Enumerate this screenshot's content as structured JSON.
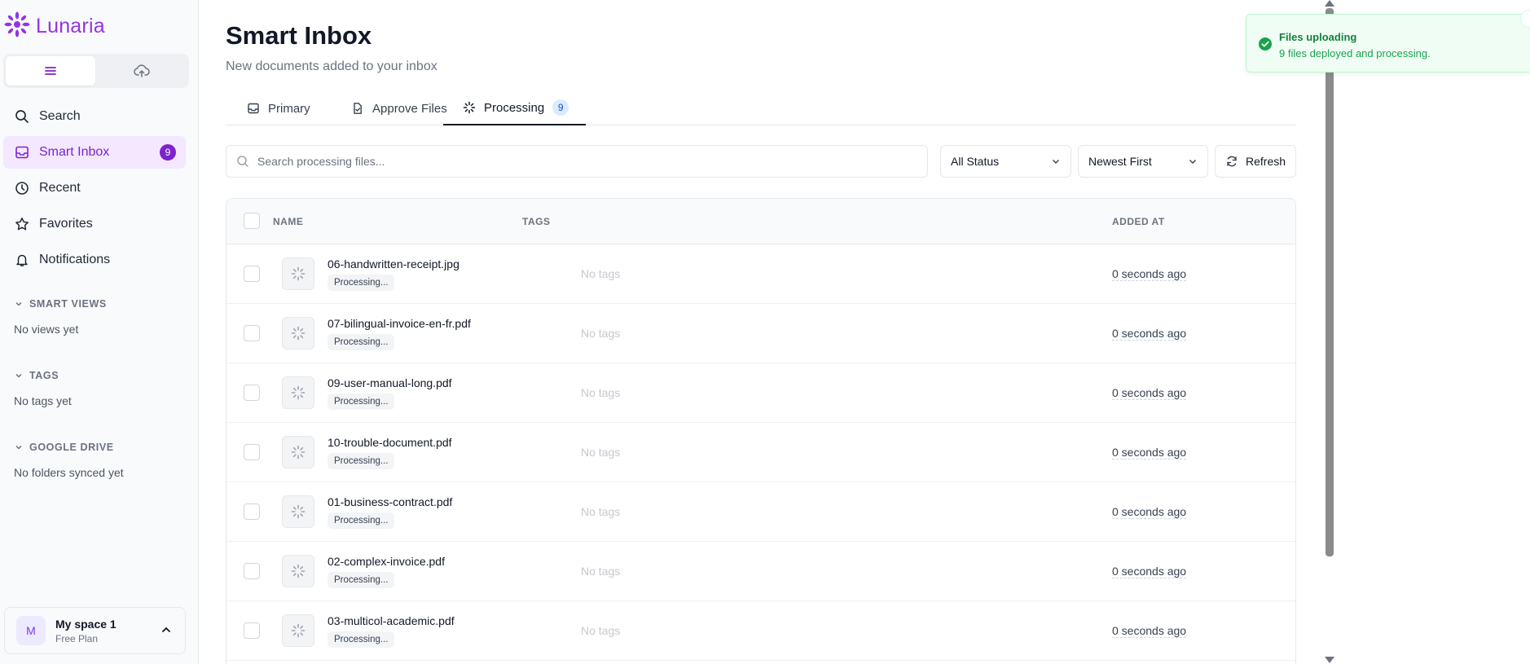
{
  "app": {
    "name": "Lunaria"
  },
  "sidebar": {
    "nav": [
      {
        "label": "Search",
        "icon": "search-icon"
      },
      {
        "label": "Smart Inbox",
        "icon": "inbox-icon",
        "count": "9",
        "active": true
      },
      {
        "label": "Recent",
        "icon": "clock-icon"
      },
      {
        "label": "Favorites",
        "icon": "star-icon"
      },
      {
        "label": "Notifications",
        "icon": "bell-icon"
      }
    ],
    "sections": [
      {
        "title": "SMART VIEWS",
        "empty": "No views yet"
      },
      {
        "title": "TAGS",
        "empty": "No tags yet"
      },
      {
        "title": "GOOGLE DRIVE",
        "empty": "No folders synced yet"
      }
    ],
    "workspace": {
      "initial": "M",
      "name": "My space 1",
      "plan": "Free Plan"
    }
  },
  "page": {
    "title": "Smart Inbox",
    "subtitle": "New documents added to your inbox"
  },
  "tabs": [
    {
      "label": "Primary",
      "icon": "inbox-icon"
    },
    {
      "label": "Approve Files",
      "icon": "file-check-icon"
    },
    {
      "label": "Processing",
      "icon": "spinner-icon",
      "badge": "9",
      "active": true
    }
  ],
  "toolbar": {
    "search_placeholder": "Search processing files...",
    "status_filter": "All Status",
    "sort": "Newest First",
    "refresh_label": "Refresh"
  },
  "table": {
    "columns": {
      "name": "NAME",
      "tags": "TAGS",
      "added": "ADDED AT"
    },
    "rows": [
      {
        "name": "06-handwritten-receipt.jpg",
        "status": "Processing...",
        "tags": "No tags",
        "added": "0 seconds ago"
      },
      {
        "name": "07-bilingual-invoice-en-fr.pdf",
        "status": "Processing...",
        "tags": "No tags",
        "added": "0 seconds ago"
      },
      {
        "name": "09-user-manual-long.pdf",
        "status": "Processing...",
        "tags": "No tags",
        "added": "0 seconds ago"
      },
      {
        "name": "10-trouble-document.pdf",
        "status": "Processing...",
        "tags": "No tags",
        "added": "0 seconds ago"
      },
      {
        "name": "01-business-contract.pdf",
        "status": "Processing...",
        "tags": "No tags",
        "added": "0 seconds ago"
      },
      {
        "name": "02-complex-invoice.pdf",
        "status": "Processing...",
        "tags": "No tags",
        "added": "0 seconds ago"
      },
      {
        "name": "03-multicol-academic.pdf",
        "status": "Processing...",
        "tags": "No tags",
        "added": "0 seconds ago"
      }
    ]
  },
  "toast": {
    "title": "Files uploading",
    "message": "9 files deployed and processing.",
    "icon": "check-circle-icon"
  },
  "colors": {
    "accent": "#7e22ce",
    "accent_bg": "#f3e8ff",
    "success": "#16a34a",
    "badge_blue": "#dbeafe"
  }
}
